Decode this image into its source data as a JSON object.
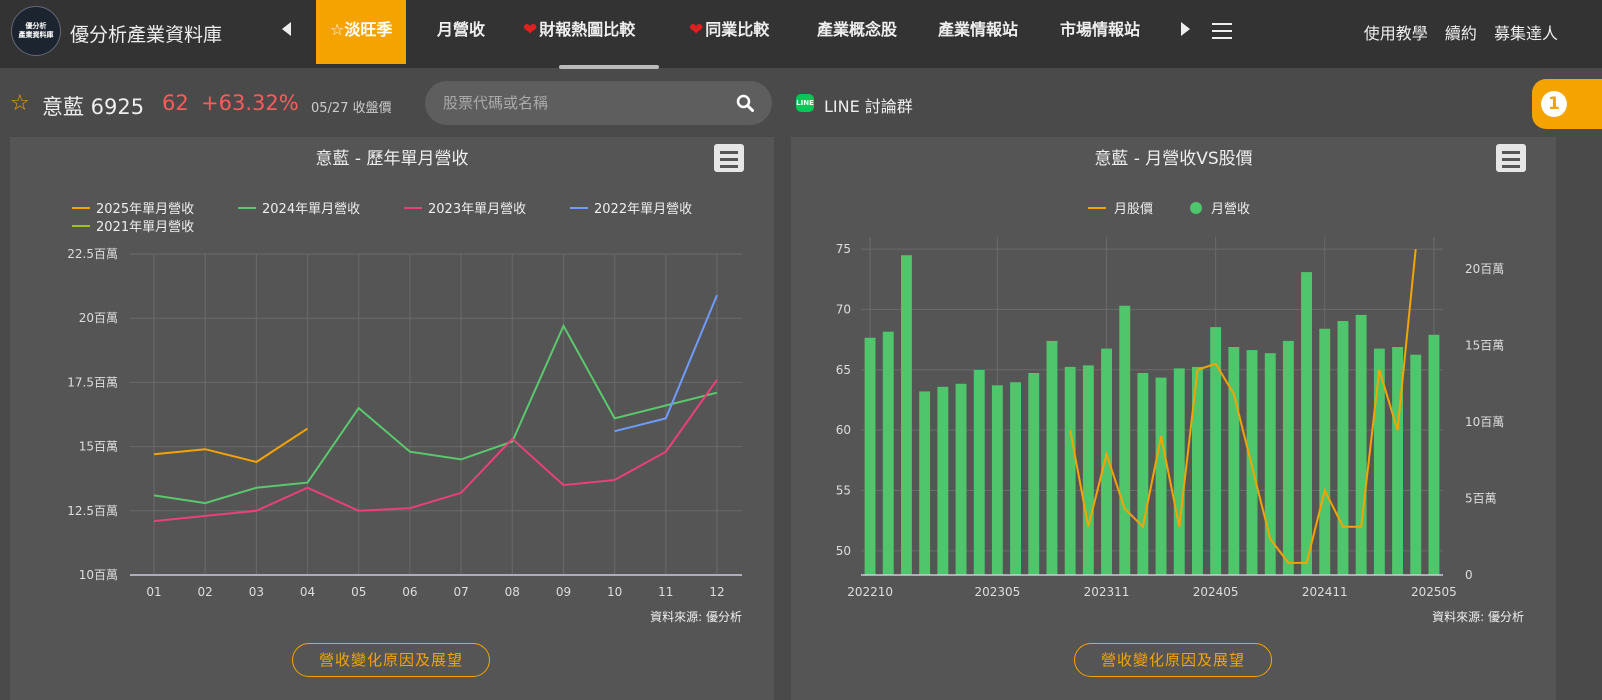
{
  "nav": {
    "logo_line1": "優分析",
    "logo_line2": "產業資料庫",
    "brand": "優分析產業資料庫",
    "items": [
      {
        "label": "淡旺季",
        "active": true,
        "icon": "star-icon"
      },
      {
        "label": "月營收"
      },
      {
        "label": "財報熱圖比較",
        "icon": "heart-icon"
      },
      {
        "label": "同業比較",
        "icon": "heart-icon"
      },
      {
        "label": "產業概念股"
      },
      {
        "label": "產業情報站"
      },
      {
        "label": "市場情報站"
      }
    ],
    "right_links": [
      "使用教學",
      "續約",
      "募集達人"
    ]
  },
  "stock": {
    "name": "意藍 6925",
    "price": "62",
    "change": "+63.32%",
    "date": "05/27 收盤價"
  },
  "search": {
    "placeholder": "股票代碼或名稱"
  },
  "line_group": {
    "icon_text": "LINE",
    "label": "LINE 討論群"
  },
  "notification": {
    "count": "1"
  },
  "colors": {
    "accent": "#f5a300",
    "up": "#ff5a5a"
  },
  "chart_data": [
    {
      "type": "line",
      "title": "意藍 - 歷年單月營收",
      "categories": [
        "01",
        "02",
        "03",
        "04",
        "05",
        "06",
        "07",
        "08",
        "09",
        "10",
        "11",
        "12"
      ],
      "y_ticks": [
        "10百萬",
        "12.5百萬",
        "15百萬",
        "17.5百萬",
        "20百萬",
        "22.5百萬"
      ],
      "ylim": [
        10,
        22.5
      ],
      "unit": "百萬",
      "legend_position": "top",
      "series": [
        {
          "name": "2025年單月營收",
          "color": "#f5a300",
          "values": [
            14.7,
            14.9,
            14.4,
            15.7,
            null,
            null,
            null,
            null,
            null,
            null,
            null,
            null
          ]
        },
        {
          "name": "2024年單月營收",
          "color": "#5bc86e",
          "values": [
            13.1,
            12.8,
            13.4,
            13.6,
            16.5,
            14.8,
            14.5,
            15.2,
            19.7,
            16.1,
            16.6,
            17.1
          ]
        },
        {
          "name": "2023年單月營收",
          "color": "#e8407a",
          "values": [
            12.1,
            12.3,
            12.5,
            13.4,
            12.5,
            12.6,
            13.2,
            15.3,
            13.5,
            13.7,
            14.8,
            17.6
          ]
        },
        {
          "name": "2022年單月營收",
          "color": "#6f9bff",
          "values": [
            null,
            null,
            null,
            null,
            null,
            null,
            null,
            null,
            null,
            15.6,
            16.1,
            20.9
          ]
        },
        {
          "name": "2021年單月營收",
          "color": "#a0c020",
          "values": []
        }
      ],
      "source": "資料來源: 優分析",
      "button": "營收變化原因及展望"
    },
    {
      "type": "bar+line",
      "title": "意藍 - 月營收VS股價",
      "x_labels": [
        "202210",
        "202305",
        "202311",
        "202405",
        "202411",
        "202505"
      ],
      "x_label_indices": [
        0,
        7,
        13,
        19,
        25,
        31
      ],
      "left_axis_ticks": [
        "50",
        "55",
        "60",
        "65",
        "70",
        "75"
      ],
      "left_ylim": [
        48,
        76
      ],
      "right_axis_ticks": [
        "0",
        "5百萬",
        "10百萬",
        "15百萬",
        "20百萬"
      ],
      "right_ylim": [
        0,
        20
      ],
      "legend_position": "top",
      "series": [
        {
          "name": "月股價",
          "color": "#f5a300",
          "type": "line",
          "axis": "left",
          "values": [
            null,
            null,
            null,
            null,
            null,
            null,
            null,
            null,
            null,
            null,
            null,
            60,
            52,
            58,
            53.5,
            52,
            59.5,
            52,
            65,
            65.5,
            63,
            57,
            51,
            49,
            49,
            55,
            52,
            52,
            65,
            60,
            75
          ]
        },
        {
          "name": "月營收",
          "color": "#4fc56c",
          "type": "bar",
          "axis": "right",
          "values": [
            15.5,
            15.9,
            20.9,
            12.0,
            12.3,
            12.5,
            13.4,
            12.4,
            12.6,
            13.2,
            15.3,
            13.6,
            13.7,
            14.8,
            17.6,
            13.2,
            12.9,
            13.5,
            13.6,
            16.2,
            14.9,
            14.7,
            14.5,
            15.3,
            19.8,
            16.1,
            16.6,
            17.0,
            14.8,
            14.9,
            14.4,
            15.7
          ]
        }
      ],
      "source": "資料來源: 優分析",
      "button": "營收變化原因及展望"
    }
  ]
}
